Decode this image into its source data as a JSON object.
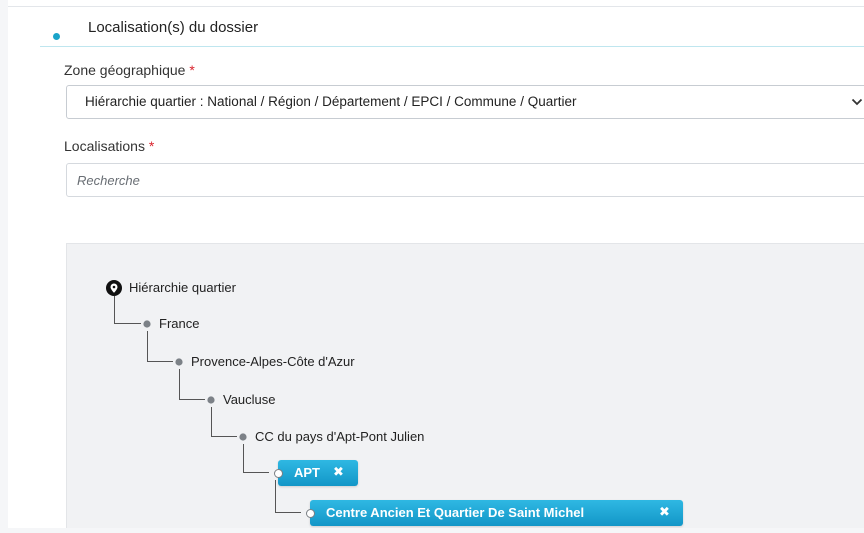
{
  "section": {
    "title": "Localisation(s) du dossier"
  },
  "zone": {
    "label": "Zone géographique",
    "required_mark": "*",
    "selected": "Hiérarchie quartier : National / Région / Département / EPCI / Commune / Quartier"
  },
  "localisations": {
    "label": "Localisations",
    "required_mark": "*",
    "search_placeholder": "Recherche"
  },
  "tree": {
    "root": {
      "label": "Hiérarchie quartier",
      "icon": "map-marker-icon"
    },
    "nodes": [
      {
        "label": "France"
      },
      {
        "label": "Provence-Alpes-Côte d'Azur"
      },
      {
        "label": "Vaucluse"
      },
      {
        "label": "CC du pays d'Apt-Pont Julien"
      }
    ],
    "selected_tags": [
      {
        "label": "APT",
        "remove": "✖"
      },
      {
        "label": "Centre Ancien Et Quartier De Saint Michel",
        "remove": "✖"
      }
    ]
  },
  "colors": {
    "accent": "#1aa4c9",
    "tag_bg": "#1fa6d4",
    "required": "#d9232d"
  }
}
